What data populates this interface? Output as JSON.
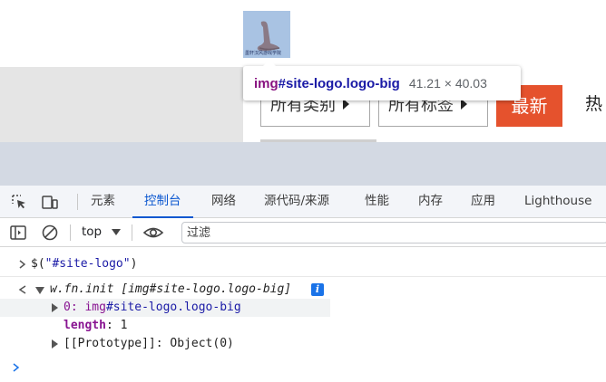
{
  "page": {
    "logo_alt": "site logo",
    "logo_caption": "墨轩汉风游戏学院",
    "category_chip": "所有类别",
    "tag_chip": "所有标签",
    "new_button": "最新",
    "hot_label": "热",
    "tooltip": {
      "tag": "img",
      "selector": "#site-logo.logo-big",
      "dimensions": "41.21 × 40.03"
    }
  },
  "devtools": {
    "toolbar_icons": [
      "inspect-element-icon",
      "device-toolbar-icon"
    ],
    "tabs": [
      {
        "label": "元素",
        "active": false
      },
      {
        "label": "控制台",
        "active": true
      },
      {
        "label": "网络",
        "active": false
      },
      {
        "label": "源代码/来源",
        "active": false
      },
      {
        "label": "性能",
        "active": false
      },
      {
        "label": "内存",
        "active": false
      },
      {
        "label": "应用",
        "active": false
      },
      {
        "label": "Lighthouse",
        "active": false
      }
    ],
    "console_toolbar": {
      "context": "top",
      "filter_placeholder": "过滤"
    },
    "console": {
      "input_prefix": "$(",
      "input_string": "\"#site-logo\"",
      "input_suffix": ")",
      "result_summary": "w.fn.init [img#site-logo.logo-big]",
      "result_prefix": "w.fn.init ",
      "result_bracket": "[img#site-logo.logo-big]",
      "info_badge": "i",
      "item0_key": "0:",
      "item0_tag": "img",
      "item0_selector": "#site-logo.logo-big",
      "length_key": "length",
      "length_sep": ":",
      "length_value": "1",
      "proto_key": "[[Prototype]]",
      "proto_sep": ":",
      "proto_value": "Object(0)"
    }
  },
  "colors": {
    "accent": "#0b57d0",
    "new_button": "#e5522d",
    "tag_purple": "#881280",
    "selector_blue": "#1a1aa6"
  }
}
